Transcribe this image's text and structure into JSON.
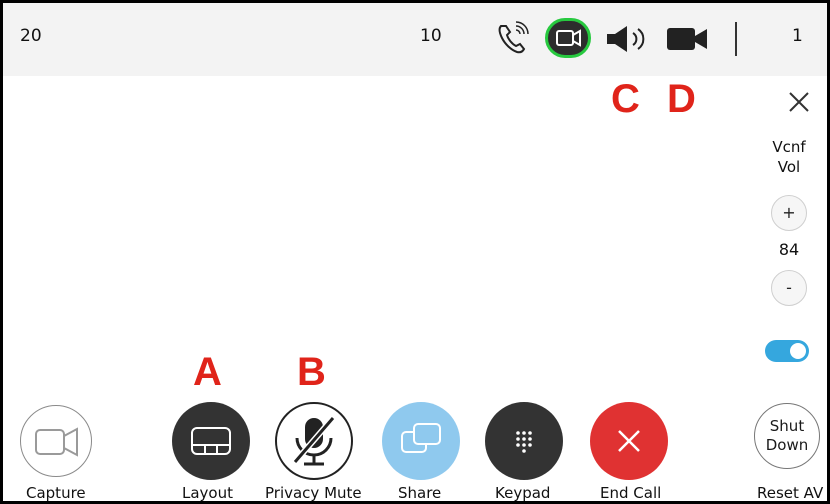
{
  "topbar": {
    "left_value": "20",
    "center_value": "10",
    "right_value": "1",
    "icons": [
      "phone-call-icon",
      "video-camera-icon",
      "speaker-icon",
      "camera-icon"
    ],
    "active_color": "#27c93f"
  },
  "markers": {
    "a": "A",
    "b": "B",
    "c": "C",
    "d": "D"
  },
  "side_panel": {
    "vol_label_line1": "Vcnf",
    "vol_label_line2": "Vol",
    "plus_label": "+",
    "volume_value": "84",
    "minus_label": "-",
    "toggle_on": true,
    "toggle_color": "#35a7de"
  },
  "controls": {
    "capture": "Capture",
    "layout": "Layout",
    "privacy_mute": "Privacy Mute",
    "share": "Share",
    "keypad": "Keypad",
    "end_call": "End Call",
    "shutdown_line1": "Shut",
    "shutdown_line2": "Down",
    "reset_av": "Reset AV"
  },
  "colors": {
    "marker": "#e0241a",
    "share": "#8fc9ee",
    "end_call": "#e03232",
    "dark_button": "#333333"
  }
}
